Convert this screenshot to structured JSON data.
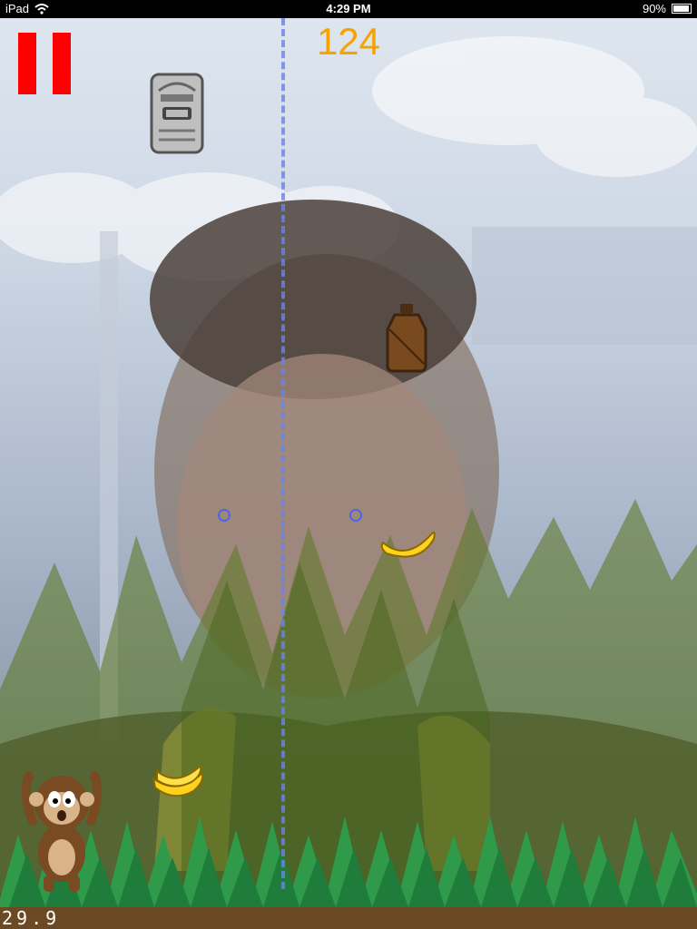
{
  "status_bar": {
    "device": "iPad",
    "time": "4:29 PM",
    "battery": "90%"
  },
  "hud": {
    "score": "124",
    "fps": "29.9"
  },
  "colors": {
    "score": "#f5a300",
    "pause": "#ff0000",
    "divider": "#6b84e3"
  },
  "objects": [
    "tiki-totem",
    "canteen",
    "banana",
    "banana",
    "monkey"
  ]
}
